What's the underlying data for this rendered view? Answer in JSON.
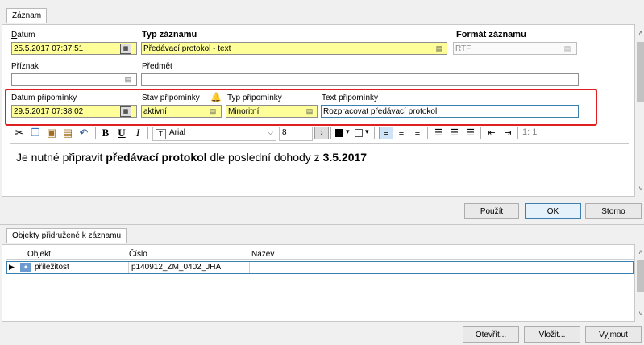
{
  "tabs": {
    "record": "Záznam",
    "related": "Objekty přidružené k záznamu"
  },
  "fields": {
    "date_label": "Datum",
    "date_value": "25.5.2017 07:37:51",
    "type_label": "Typ záznamu",
    "type_value": "Předávací protokol - text",
    "format_label": "Formát záznamu",
    "format_value": "RTF",
    "flag_label": "Příznak",
    "flag_value": "",
    "subject_label": "Předmět",
    "subject_value": ""
  },
  "reminder": {
    "date_label": "Datum připomínky",
    "date_value": "29.5.2017 07:38:02",
    "state_label": "Stav připomínky",
    "state_value": "aktivní",
    "type_label": "Typ připomínky",
    "type_value": "Minoritní",
    "text_label": "Text připomínky",
    "text_value": "Rozpracovat předávací protokol"
  },
  "toolbar": {
    "bold": "B",
    "underline": "U",
    "italic": "I",
    "font": "Arial",
    "size": "8",
    "position": "1: 1"
  },
  "editor": {
    "text_before": "Je nutné připravit ",
    "text_bold": "předávací protokol",
    "text_middle": " dle poslední dohody z ",
    "text_date": "3.5.2017"
  },
  "buttons": {
    "apply": "Použít",
    "ok": "OK",
    "cancel": "Storno",
    "open": "Otevřít...",
    "insert": "Vložit...",
    "remove": "Vyjmout"
  },
  "table": {
    "columns": [
      "Objekt",
      "Číslo",
      "Název"
    ],
    "rows": [
      {
        "object": "příležitost",
        "number": "p140912_ZM_0402_JHA",
        "name": ""
      }
    ]
  },
  "colors": {
    "highlight_yellow": "#ffff99",
    "red_frame": "#e02020",
    "selection_blue": "#3c7fb1"
  }
}
